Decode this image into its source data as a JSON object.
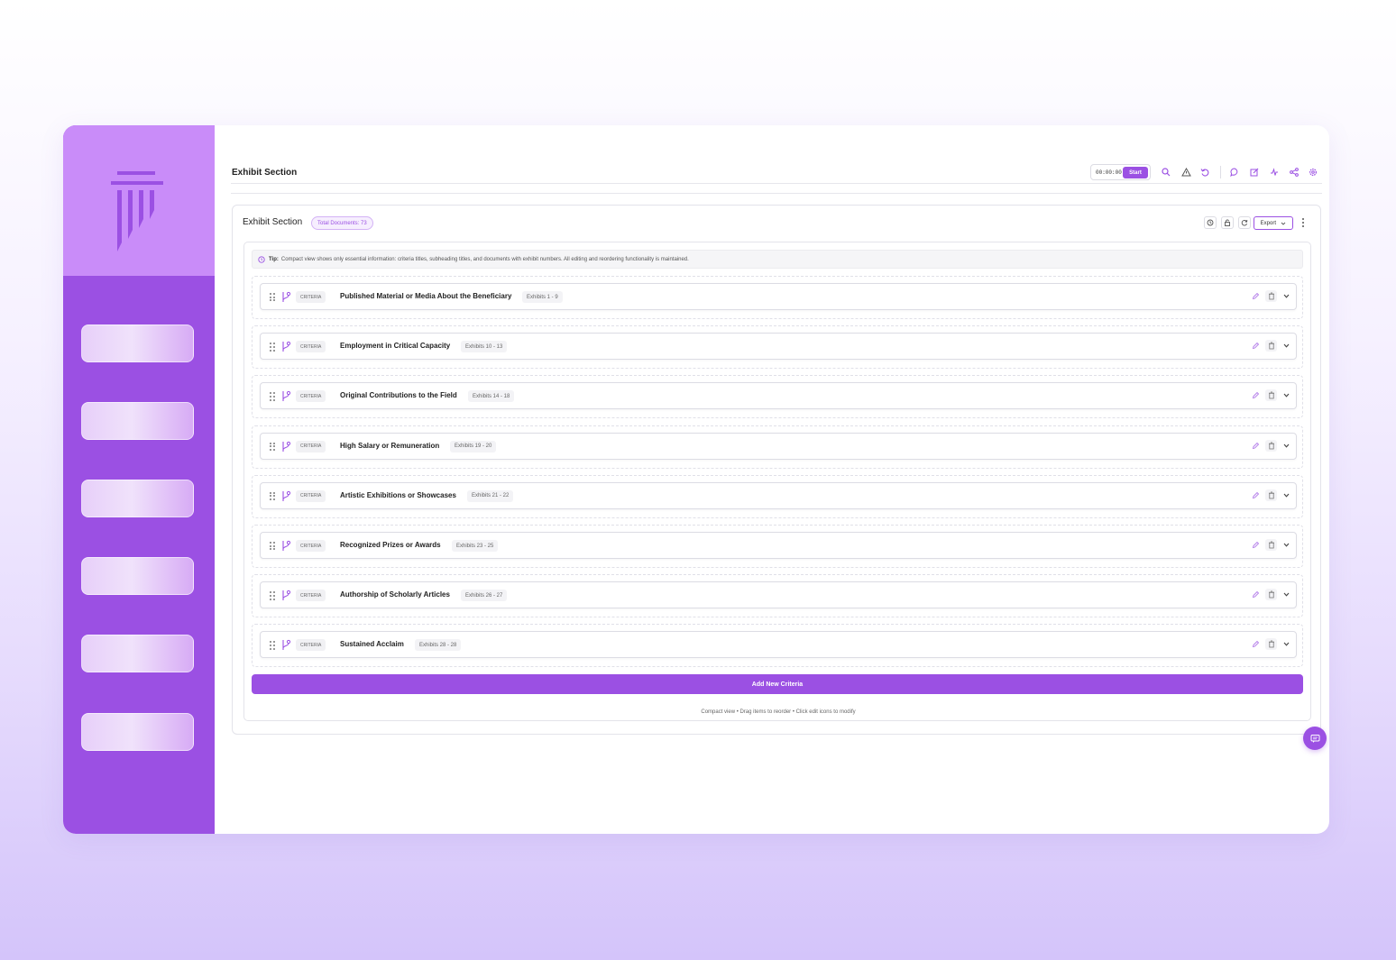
{
  "header": {
    "page_title": "Exhibit Section",
    "timer": "00:00:00",
    "start_label": "Start"
  },
  "section": {
    "title": "Exhibit Section",
    "total_documents": "Total Documents: 73",
    "export_label": "Export"
  },
  "tip": {
    "label": "Tip:",
    "text": "Compact view shows only essential information: criteria titles, subheading titles, and documents with exhibit numbers. All editing and reordering functionality is maintained."
  },
  "criteria": [
    {
      "tag": "CRITERIA",
      "title": "Published Material or Media About the Beneficiary",
      "exhibits": "Exhibits 1 - 9"
    },
    {
      "tag": "CRITERIA",
      "title": "Employment in Critical Capacity",
      "exhibits": "Exhibits 10 - 13"
    },
    {
      "tag": "CRITERIA",
      "title": "Original Contributions to the Field",
      "exhibits": "Exhibits 14 - 18"
    },
    {
      "tag": "CRITERIA",
      "title": "High Salary or Remuneration",
      "exhibits": "Exhibits 19 - 20"
    },
    {
      "tag": "CRITERIA",
      "title": "Artistic Exhibitions or Showcases",
      "exhibits": "Exhibits 21 - 22"
    },
    {
      "tag": "CRITERIA",
      "title": "Recognized Prizes or Awards",
      "exhibits": "Exhibits 23 - 25"
    },
    {
      "tag": "CRITERIA",
      "title": "Authorship of Scholarly Articles",
      "exhibits": "Exhibits 26 - 27"
    },
    {
      "tag": "CRITERIA",
      "title": "Sustained Acclaim",
      "exhibits": "Exhibits 28 - 28"
    }
  ],
  "add_button_label": "Add New Criteria",
  "footer_note": "Compact view • Drag items to reorder • Click edit icons to modify",
  "icons": {
    "toolbar": [
      "search-icon",
      "warning-icon",
      "undo-icon",
      "comment-icon",
      "edit-note-icon",
      "activity-icon",
      "share-icon",
      "settings-icon"
    ],
    "section": [
      "history-icon",
      "lock-icon",
      "refresh-icon",
      "chevron-down-icon",
      "more-vertical-icon"
    ],
    "row": [
      "drag-handle-icon",
      "branch-icon",
      "pencil-icon",
      "trash-icon",
      "chevron-down-icon"
    ]
  },
  "colors": {
    "accent": "#9b50e3",
    "sidebar": "#9b50e3",
    "sidebar_logo_bg": "#c98cf9"
  }
}
